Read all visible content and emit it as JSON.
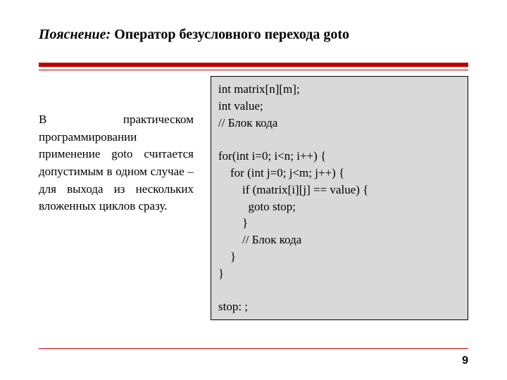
{
  "title": {
    "prefix": "Пояснение:",
    "main": " Оператор безусловного перехода goto"
  },
  "body": {
    "description": "В практическом программировании применение goto считается допустимым в одном случае – для выхода из нескольких вложенных циклов сразу.",
    "code": "int matrix[n][m];\nint value;\n// Блок кода\n\nfor(int i=0; i<n; i++) {\n    for (int j=0; j<m; j++) {\n        if (matrix[i][j] == value) {\n          goto stop;\n        }\n        // Блок кода\n    }\n}\n\nstop: ;"
  },
  "page": {
    "number": "9"
  }
}
